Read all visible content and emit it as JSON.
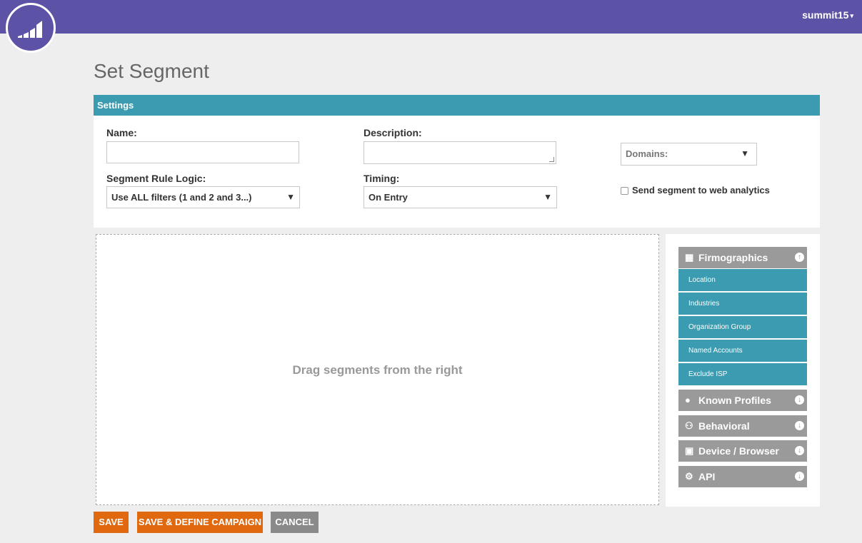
{
  "header": {
    "username": "summit15",
    "caret": "▾",
    "logo_icon": "marketo-bars-icon"
  },
  "page": {
    "title": "Set Segment"
  },
  "settings": {
    "header": "Settings",
    "name_label": "Name:",
    "name_value": "",
    "description_label": "Description:",
    "description_value": "",
    "domains_label": "Domains:",
    "rule_logic_label": "Segment Rule Logic:",
    "rule_logic_value": "Use ALL filters (1 and 2 and 3...)",
    "timing_label": "Timing:",
    "timing_value": "On Entry",
    "analytics_label": "Send segment to web analytics",
    "analytics_checked": false
  },
  "dropzone": {
    "text": "Drag segments from the right"
  },
  "palette": {
    "firmographics": {
      "label": "Firmographics",
      "icon": "building-icon",
      "toggle": "↑",
      "items": [
        "Location",
        "Industries",
        "Organization Group",
        "Named Accounts",
        "Exclude ISP"
      ]
    },
    "known_profiles": {
      "label": "Known Profiles",
      "icon": "person-icon",
      "toggle": "↓"
    },
    "behavioral": {
      "label": "Behavioral",
      "icon": "behavior-icon",
      "toggle": "↓"
    },
    "device_browser": {
      "label": "Device / Browser",
      "icon": "device-icon",
      "toggle": "↓"
    },
    "api": {
      "label": "API",
      "icon": "gears-icon",
      "toggle": "↓"
    }
  },
  "actions": {
    "save": "SAVE",
    "save_define": "SAVE & DEFINE CAMPAIGN",
    "cancel": "CANCEL"
  },
  "colors": {
    "topbar": "#5c53a6",
    "accent_teal": "#3b9bb0",
    "category_gray": "#9a9a9a",
    "button_orange": "#e0680f",
    "button_gray": "#8a8a8a"
  }
}
